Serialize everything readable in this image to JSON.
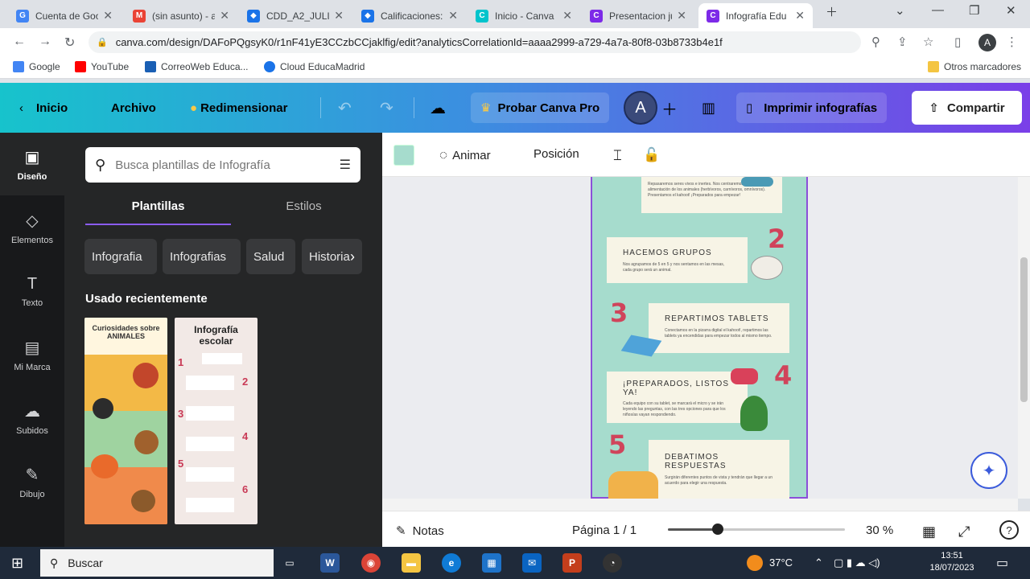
{
  "browser": {
    "tabs": [
      {
        "title": "Cuenta de Goo",
        "fav": "G",
        "color": "#4285f4"
      },
      {
        "title": "(sin asunto) - a",
        "fav": "M",
        "color": "#ea4335"
      },
      {
        "title": "CDD_A2_JULIO",
        "fav": "◆",
        "color": "#1a73e8"
      },
      {
        "title": "Calificaciones:",
        "fav": "◆",
        "color": "#1a73e8"
      },
      {
        "title": "Inicio - Canva",
        "fav": "C",
        "color": "#00c4cc"
      },
      {
        "title": "Presentacion ju",
        "fav": "C",
        "color": "#7d2ae8"
      },
      {
        "title": "Infografía Edu",
        "fav": "C",
        "color": "#7d2ae8"
      }
    ],
    "url": "canva.com/design/DAFoPQgsyK0/r1nF41yE3CCzbCCjaklfig/edit?analyticsCorrelationId=aaaa2999-a729-4a7a-80f8-03b8733b4e1f",
    "profile_initial": "A",
    "bookmarks": [
      "Google",
      "YouTube",
      "CorreoWeb Educa...",
      "Cloud EducaMadrid"
    ],
    "other_bookmarks": "Otros marcadores"
  },
  "canva_bar": {
    "home": "Inicio",
    "file": "Archivo",
    "resize": "Redimensionar",
    "try_pro": "Probar Canva Pro",
    "avatar": "A",
    "print": "Imprimir infografías",
    "share": "Compartir"
  },
  "rail": [
    {
      "label": "Diseño",
      "icon": "▣"
    },
    {
      "label": "Elementos",
      "icon": "◇"
    },
    {
      "label": "Texto",
      "icon": "T"
    },
    {
      "label": "Mi Marca",
      "icon": "▤"
    },
    {
      "label": "Subidos",
      "icon": "☁"
    },
    {
      "label": "Dibujo",
      "icon": "✎"
    }
  ],
  "panel": {
    "search_placeholder": "Busca plantillas de Infografía",
    "tab_templates": "Plantillas",
    "tab_styles": "Estilos",
    "chips": [
      "Infografia",
      "Infografias",
      "Salud",
      "Historia"
    ],
    "recent": "Usado recientemente",
    "thumb1_title": "Curiosidades sobre ANIMALES",
    "thumb2_title": "Infografía escolar",
    "thumb2_steps": [
      "1",
      "2",
      "3",
      "4",
      "5",
      "6"
    ]
  },
  "context_bar": {
    "animate": "Animar",
    "position": "Posición"
  },
  "canvas": {
    "step2_title": "HACEMOS GRUPOS",
    "step2_text": "Nos agrupamos de 5 en 5 y nos sentamos en las mesas, cada grupo será un animal.",
    "step3_title": "REPARTIMOS TABLETS",
    "step3_text": "Conectamos en la pizarra digital el kahoot!, repartimos las tablets ya encendidas para empezar todos al mismo tiempo.",
    "step4_title": "¡PREPARADOS, LISTOS YA!",
    "step4_text": "Cada equipo con su tablet, se marcará el micro y se irán leyendo las preguntas, con las tres opciones para que los niños/as vayan respondiendo.",
    "step5_title": "DEBATIMOS RESPUESTAS",
    "step5_text": "Surgirán diferentes puntos de vista y tendrán que llegar a un acuerdo para elegir una respuesta.",
    "top_text": "Repasaremos seres vivos e inertes. Nos centraremos en los tipos de alimentación de los animales (herbívoros, carnívoros, omnívoros). Presentamos el kahoot! ¡Preparados para empezar!",
    "numbers": [
      "2",
      "3",
      "4",
      "5"
    ]
  },
  "footer": {
    "notes": "Notas",
    "page": "Página 1 / 1",
    "zoom": "30 %",
    "zoom_fraction": 0.28
  },
  "taskbar": {
    "search": "Buscar",
    "temp": "37°C",
    "time": "13:51",
    "date": "18/07/2023"
  }
}
